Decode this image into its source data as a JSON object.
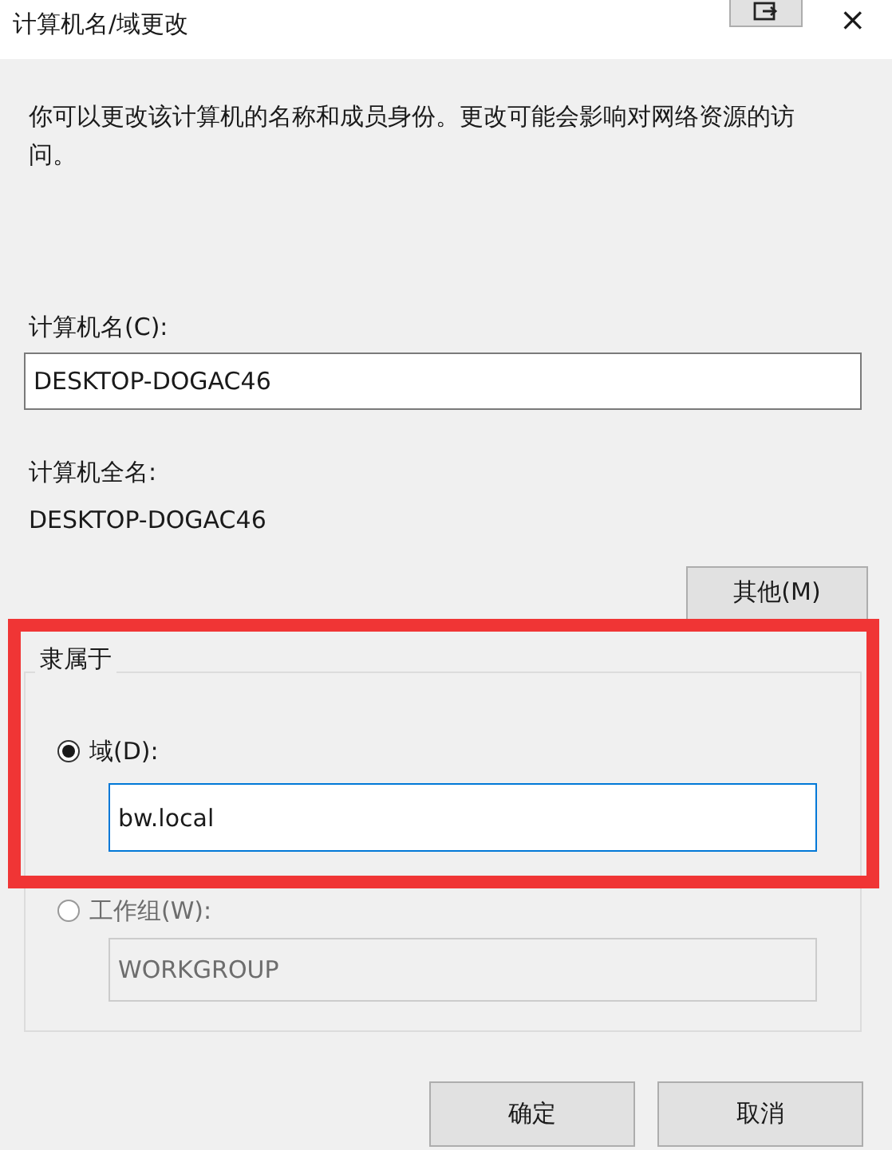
{
  "window": {
    "title": "计算机名/域更改",
    "controls": [
      "×"
    ]
  },
  "description": "你可以更改该计算机的名称和成员身份。更改可能会影响对网络资源的访问。",
  "computer_name": {
    "label": "计算机名(C):",
    "value": "DESKTOP-DOGAC46"
  },
  "full_name": {
    "label": "计算机全名:",
    "value": "DESKTOP-DOGAC46"
  },
  "other_button": "其他(M)",
  "member_of": {
    "title": "隶属于",
    "options": [
      {
        "label": "域(D):",
        "selected": true,
        "value": "bw.local",
        "disabled": false
      },
      {
        "label": "工作组(W):",
        "selected": false,
        "value": "WORKGROUP",
        "disabled": true
      }
    ]
  },
  "buttons": [
    "确定",
    "取消"
  ],
  "annotation": {
    "kind": "highlight",
    "color": "#f03535"
  }
}
